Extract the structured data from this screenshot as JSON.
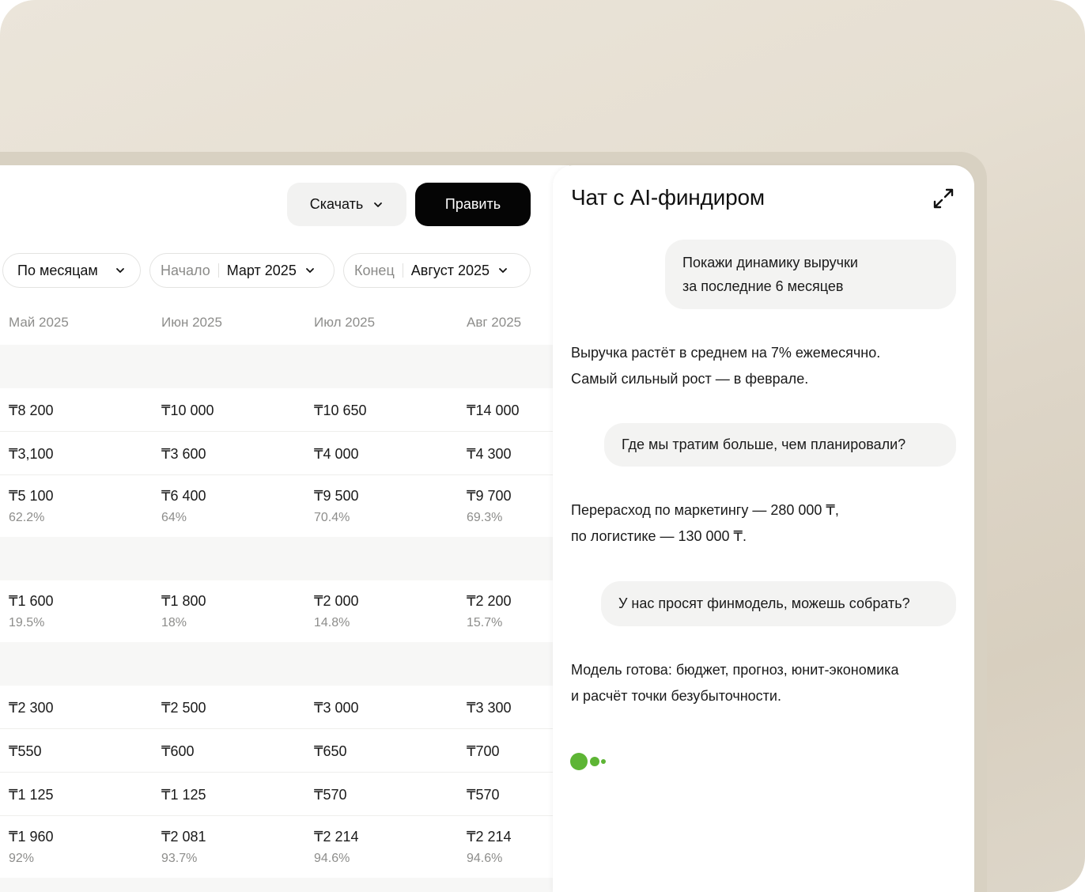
{
  "toolbar": {
    "download_label": "Скачать",
    "edit_label": "Править"
  },
  "filters": {
    "period_value": "По месяцам",
    "start_label": "Начало",
    "start_value": "Март 2025",
    "end_label": "Конец",
    "end_value": "Август 2025"
  },
  "table": {
    "columns": [
      "Май 2025",
      "Июн 2025",
      "Июл 2025",
      "Авг 2025"
    ],
    "rows": [
      {
        "values": [
          "₸8 200",
          "₸10 000",
          "₸10 650",
          "₸14 000"
        ]
      },
      {
        "values": [
          "₸3,100",
          "₸3 600",
          "₸4 000",
          "₸4 300"
        ]
      },
      {
        "values": [
          "₸5 100",
          "₸6 400",
          "₸9 500",
          "₸9 700"
        ],
        "pcts": [
          "62.2%",
          "64%",
          "70.4%",
          "69.3%"
        ]
      },
      {
        "values": [
          "₸1 600",
          "₸1 800",
          "₸2 000",
          "₸2 200"
        ],
        "pcts": [
          "19.5%",
          "18%",
          "14.8%",
          "15.7%"
        ]
      },
      {
        "values": [
          "₸2 300",
          "₸2 500",
          "₸3 000",
          "₸3 300"
        ]
      },
      {
        "values": [
          "₸550",
          "₸600",
          "₸650",
          "₸700"
        ]
      },
      {
        "values": [
          "₸1 125",
          "₸1 125",
          "₸570",
          "₸570"
        ]
      },
      {
        "values": [
          "₸1 960",
          "₸2 081",
          "₸2 214",
          "₸2 214"
        ],
        "pcts": [
          "92%",
          "93.7%",
          "94.6%",
          "94.6%"
        ]
      }
    ]
  },
  "chat": {
    "title": "Чат с AI-финдиром",
    "icons": {
      "expand": "expand-icon",
      "typing": "typing-indicator"
    },
    "accent_color": "#5db534",
    "messages": [
      {
        "role": "user",
        "lines": [
          "Покажи динамику выручки",
          "за последние 6 месяцев"
        ]
      },
      {
        "role": "assistant",
        "lines": [
          "Выручка растёт в среднем на 7% ежемесячно.",
          "Самый сильный рост — в феврале."
        ]
      },
      {
        "role": "user",
        "lines": [
          "Где мы тратим больше, чем планировали?"
        ]
      },
      {
        "role": "assistant",
        "lines": [
          "Перерасход по маркетингу — 280 000 ₸,",
          "по логистике — 130 000 ₸."
        ]
      },
      {
        "role": "user",
        "lines": [
          "У нас просят финмодель, можешь собрать?"
        ]
      },
      {
        "role": "assistant",
        "lines": [
          "Модель готова: бюджет, прогноз, юнит-экономика",
          "и расчёт точки безубыточности."
        ]
      }
    ]
  }
}
